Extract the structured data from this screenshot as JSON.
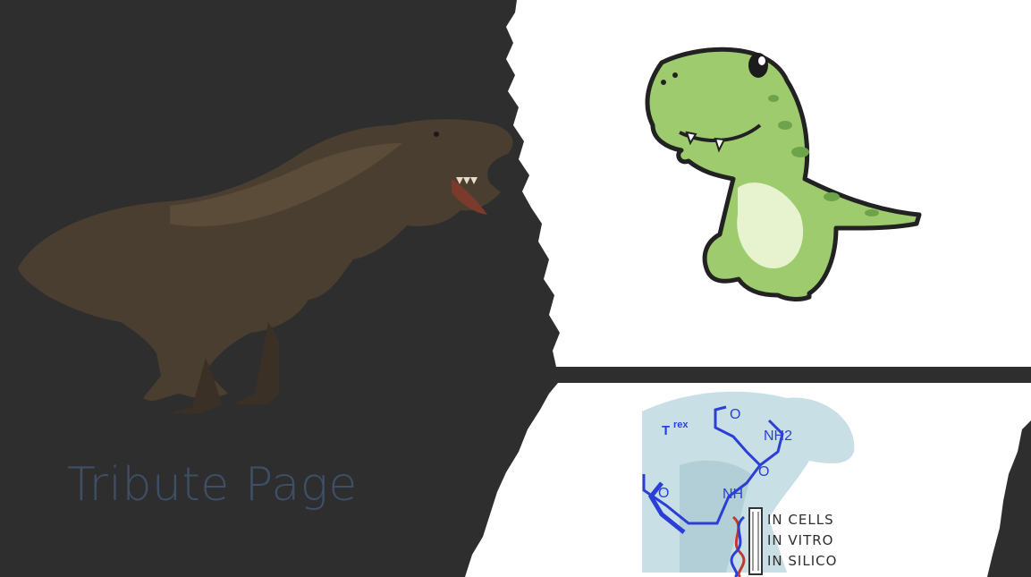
{
  "page": {
    "title": "Tribute Page",
    "background_color": "#2e2e2e",
    "title_color": "#3e4f66"
  },
  "images": {
    "realistic_trex": {
      "name": "realistic-trex-image"
    },
    "cartoon_trex": {
      "name": "cartoon-dinosaur-image"
    },
    "trex_logo": {
      "name": "trex-lab-logo",
      "brand": "T",
      "brand_sup": "rex",
      "molecule_labels": [
        "O",
        "NH",
        "O",
        "NH2",
        "O"
      ],
      "lines": [
        "IN CELLS",
        "IN VITRO",
        "IN SILICO"
      ]
    }
  }
}
